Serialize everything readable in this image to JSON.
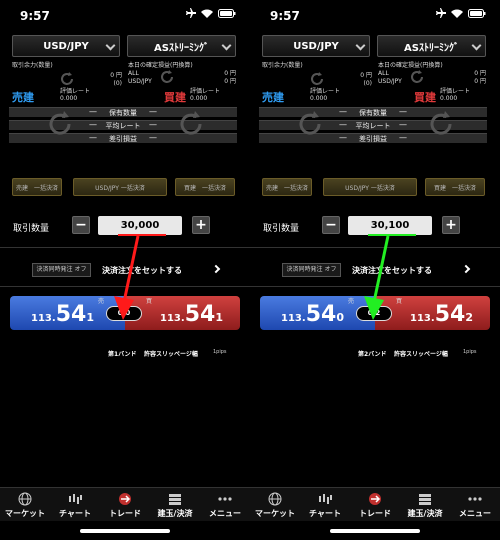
{
  "status_bar": {
    "time": "9:57"
  },
  "top": {
    "pair": "USD/JPY",
    "stream": "ASｽﾄﾘｰﾐﾝｸﾞ"
  },
  "info": {
    "margin_label": "取引余力(数量)",
    "margin_value": "0 円",
    "margin_sub": "(0)",
    "pnl_label": "本日の確定損益(円換算)",
    "pnl_all_label": "ALL",
    "pnl_all_value": "0 円",
    "pnl_pair_label": "USD/JPY",
    "pnl_pair_value": "0 円"
  },
  "positions": {
    "sell_label": "売建",
    "buy_label": "買建",
    "eval_rate_label": "評価レート",
    "eval_value": "0.000",
    "rows": [
      "保有数量",
      "平均レート",
      "差引損益"
    ],
    "dash": "—"
  },
  "settle_buttons": {
    "sell": "売建　一括決済",
    "pair": "USD/JPY 一括決済",
    "buy": "買建　一括決済"
  },
  "quantity": {
    "label": "取引数量",
    "minus": "−",
    "plus": "+"
  },
  "oco": {
    "toggle": "決済同時発注 オフ",
    "link": "決済注文をセットする"
  },
  "price_labels": {
    "sell": "売",
    "buy": "買"
  },
  "slippage": {
    "label": "許容スリッページ幅",
    "pips": "1pips"
  },
  "panels": [
    {
      "quantity_value": "30,000",
      "sell_price": {
        "big": "113.",
        "main": "54",
        "pip": "1"
      },
      "buy_price": {
        "big": "113.",
        "main": "54",
        "pip": "1"
      },
      "spread": "0.0",
      "band": "第1バンド",
      "marker_color": "#ff1a1a"
    },
    {
      "quantity_value": "30,100",
      "sell_price": {
        "big": "113.",
        "main": "54",
        "pip": "0"
      },
      "buy_price": {
        "big": "113.",
        "main": "54",
        "pip": "2"
      },
      "spread": "0.2",
      "band": "第2バンド",
      "marker_color": "#22ee22"
    }
  ],
  "tabs": [
    {
      "label": "マーケット",
      "icon": "globe-icon"
    },
    {
      "label": "チャート",
      "icon": "candlestick-icon"
    },
    {
      "label": "トレード",
      "icon": "trade-icon"
    },
    {
      "label": "建玉/決済",
      "icon": "positions-icon"
    },
    {
      "label": "メニュー",
      "icon": "more-icon"
    }
  ]
}
